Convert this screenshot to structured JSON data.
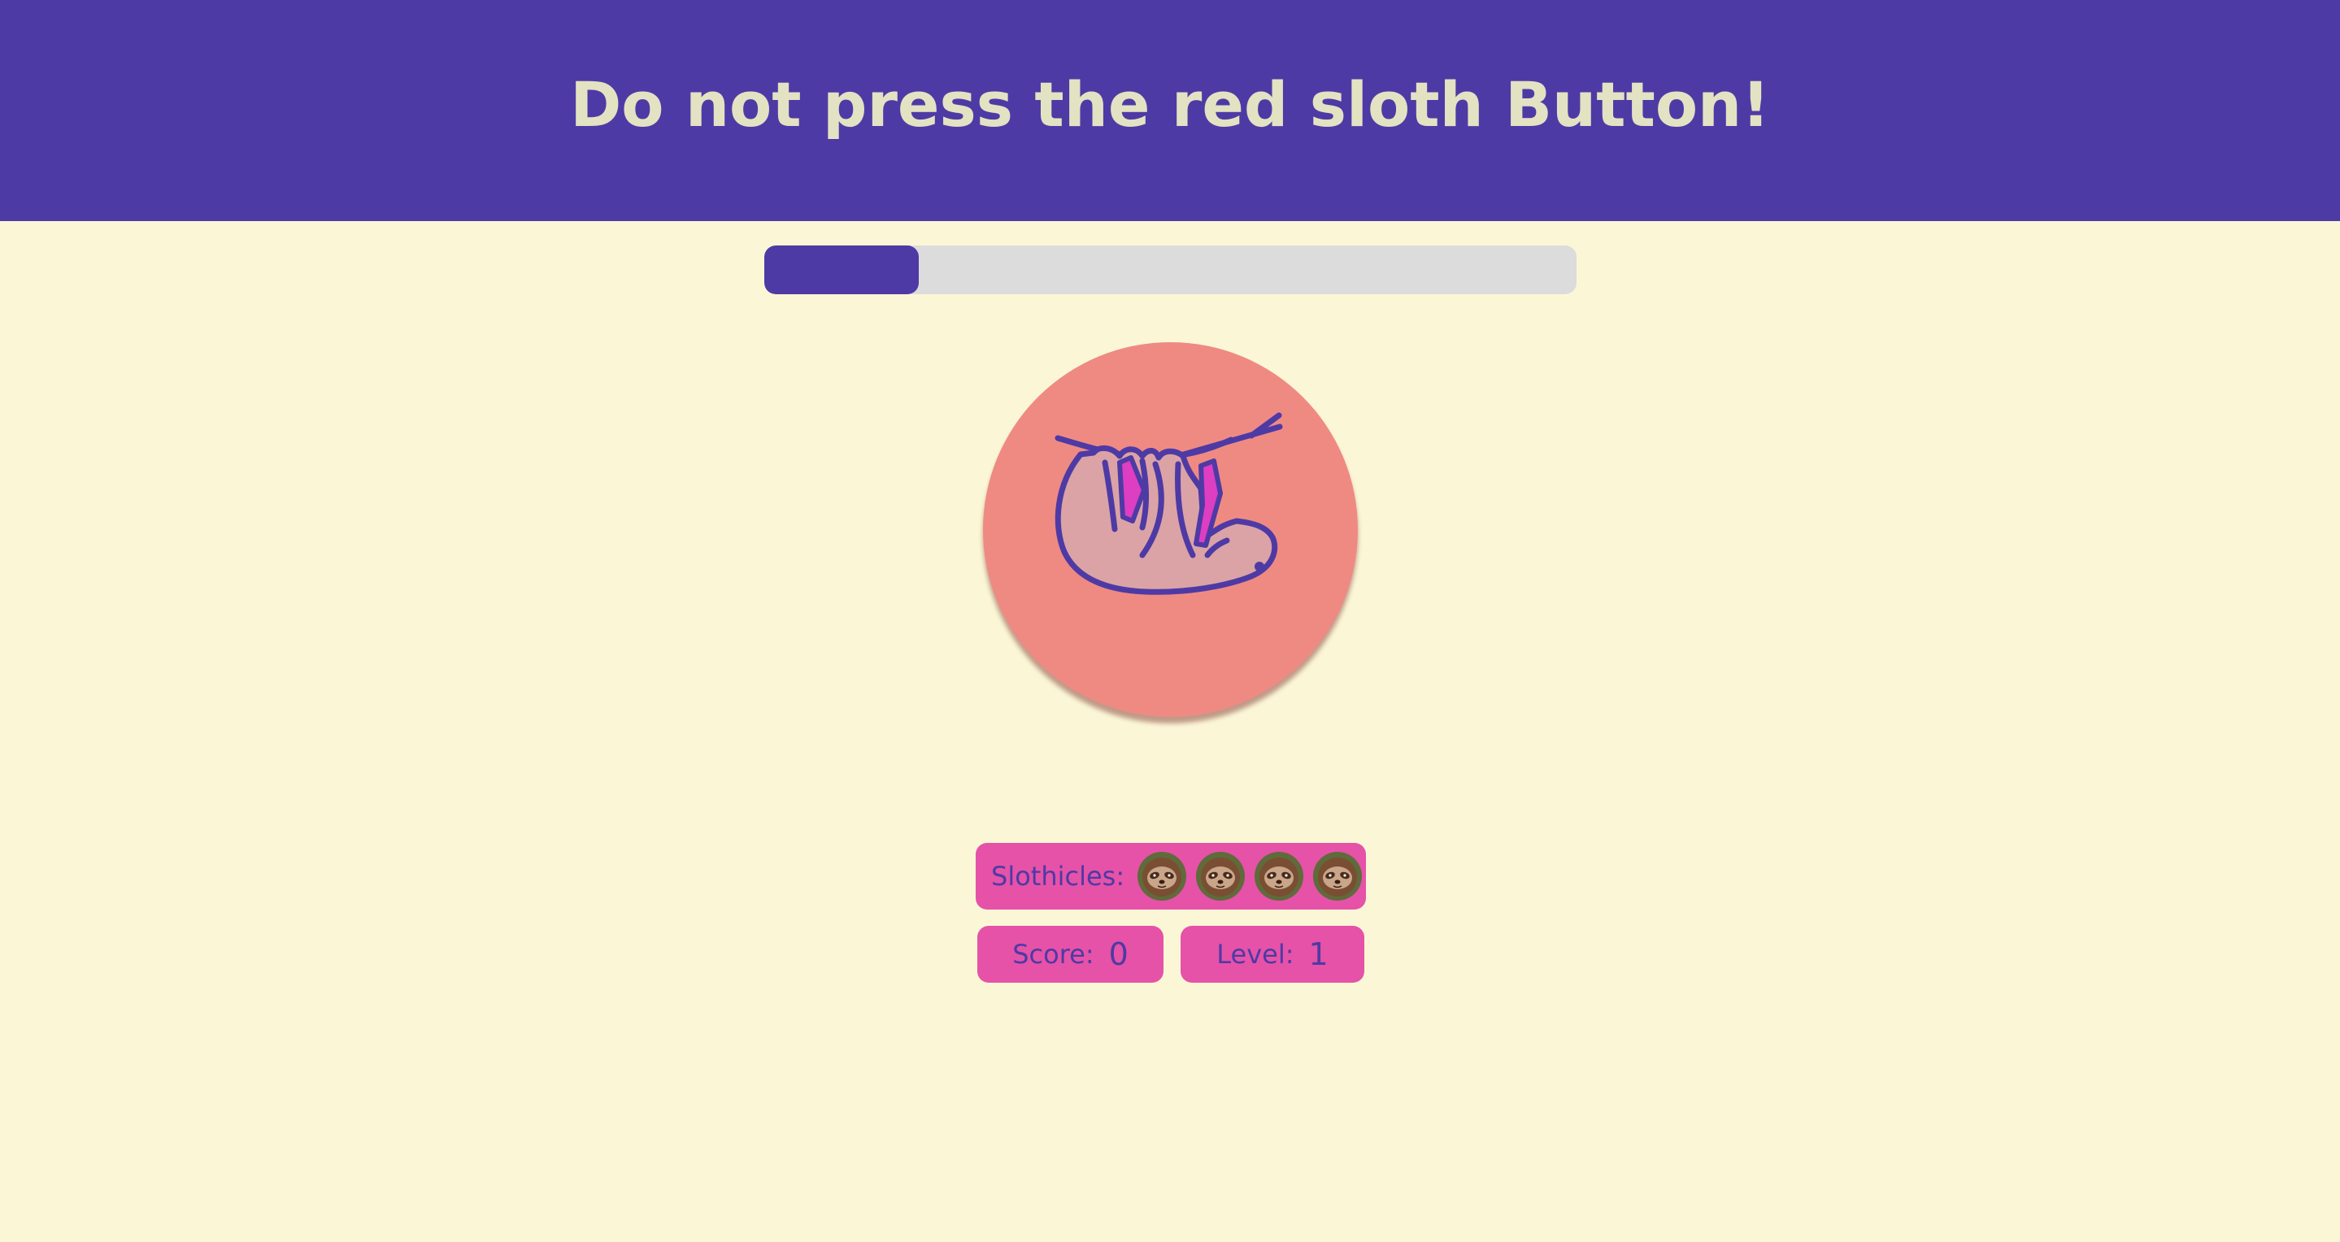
{
  "header": {
    "title": "Do not press the red sloth Button!"
  },
  "progress": {
    "fraction": 0.19
  },
  "game_button": {
    "icon": "sloth-icon"
  },
  "lives": {
    "label": "Slothicles:",
    "count": 4,
    "icon": "sloth-face-icon"
  },
  "score": {
    "label": "Score:",
    "value": "0"
  },
  "level": {
    "label": "Level:",
    "value": "1"
  },
  "colors": {
    "header_bg": "#4e3aa5",
    "title_text": "#e3e2c3",
    "page_bg": "#fbf7d6",
    "button_red": "#ef8a83",
    "panel_pink": "#e552a8",
    "accent_purple": "#4e3aa5",
    "track_gray": "#dcdcdc"
  }
}
